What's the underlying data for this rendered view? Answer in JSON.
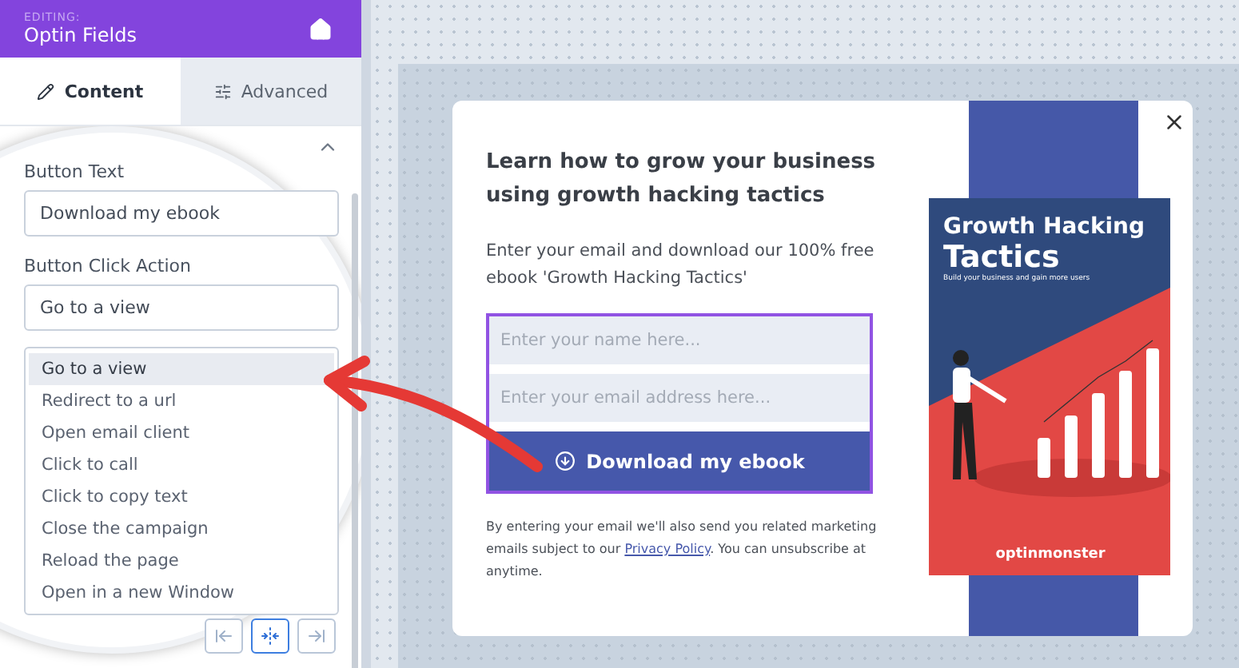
{
  "header": {
    "eyebrow": "EDITING:",
    "title": "Optin Fields"
  },
  "tabs": [
    {
      "label": "Content",
      "kind": "pencil",
      "selected": true
    },
    {
      "label": "Advanced",
      "kind": "sliders",
      "selected": false
    }
  ],
  "button_text": {
    "label": "Button Text",
    "value": "Download my ebook"
  },
  "click_action": {
    "label": "Button Click Action",
    "value": "Go to a view",
    "options": [
      {
        "label": "Go to a view",
        "selected": true
      },
      {
        "label": "Redirect to a url",
        "selected": false
      },
      {
        "label": "Open email client",
        "selected": false
      },
      {
        "label": "Click to call",
        "selected": false
      },
      {
        "label": "Click to copy text",
        "selected": false
      },
      {
        "label": "Close the campaign",
        "selected": false
      },
      {
        "label": "Reload the page",
        "selected": false
      },
      {
        "label": "Open in a new Window",
        "selected": false
      }
    ]
  },
  "alignment": [
    {
      "kind": "left",
      "selected": false
    },
    {
      "kind": "center",
      "selected": true
    },
    {
      "kind": "right",
      "selected": false
    }
  ],
  "popup": {
    "heading": "Learn how to grow your business using growth hacking tactics",
    "text": "Enter your email and download our 100% free ebook 'Growth Hacking Tactics'",
    "name_placeholder": "Enter your name here...",
    "email_placeholder": "Enter your email address here...",
    "button": "Download my ebook",
    "disclaimer_before": "By entering your email we'll also send you related marketing emails subject to our ",
    "disclaimer_link": "Privacy Policy",
    "disclaimer_after": ". You can unsubscribe at anytime.",
    "book": {
      "title_top": "Growth Hacking",
      "title_bottom": "Tactics",
      "subtitle": "Build your business and gain more users",
      "logo": "optinmonster"
    }
  }
}
